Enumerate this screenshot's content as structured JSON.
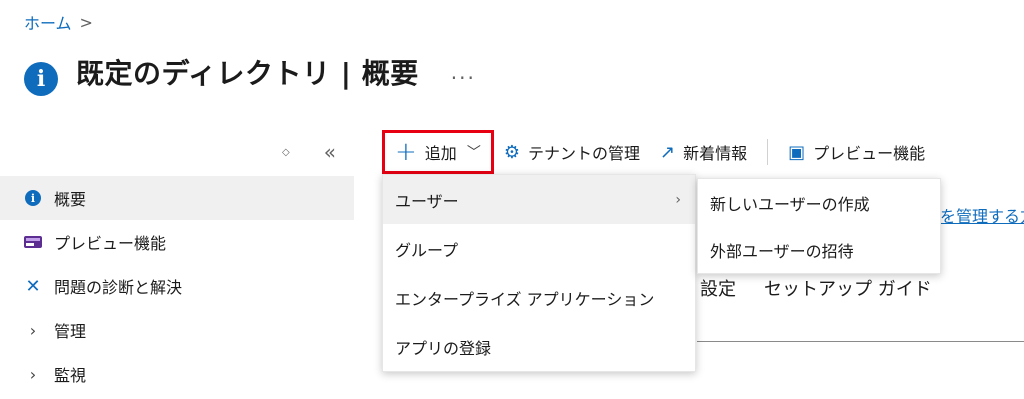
{
  "breadcrumb": {
    "home": "ホーム",
    "separator": ">"
  },
  "header": {
    "title": "既定のディレクトリ | 概要",
    "more": "..."
  },
  "nav_controls": {
    "updown": "◇",
    "collapse": "«"
  },
  "sidebar": {
    "items": [
      {
        "label": "概要",
        "icon": "info-icon",
        "active": true
      },
      {
        "label": "プレビュー機能",
        "icon": "preview-features-icon"
      },
      {
        "label": "問題の診断と解決",
        "icon": "tools-icon"
      },
      {
        "label": "管理",
        "icon": "chevron-right-icon"
      },
      {
        "label": "監視",
        "icon": "chevron-right-icon"
      }
    ]
  },
  "toolbar": {
    "add": {
      "label": "追加",
      "highlight_color": "#e60012"
    },
    "manage_tenants": "テナントの管理",
    "whats_new": "新着情報",
    "preview_features": "プレビュー機能"
  },
  "add_menu": {
    "items": [
      {
        "label": "ユーザー",
        "has_submenu": true
      },
      {
        "label": "グループ"
      },
      {
        "label": "エンタープライズ アプリケーション"
      },
      {
        "label": "アプリの登録"
      }
    ]
  },
  "user_submenu": {
    "items": [
      {
        "label": "新しいユーザーの作成"
      },
      {
        "label": "外部ユーザーの招待"
      }
    ]
  },
  "background": {
    "link_partial": "を管理する方",
    "tab_partial": "設定",
    "tab_setup_guide": "セットアップ ガイド"
  },
  "colors": {
    "accent": "#0f6cbd",
    "highlight": "#e60012"
  }
}
